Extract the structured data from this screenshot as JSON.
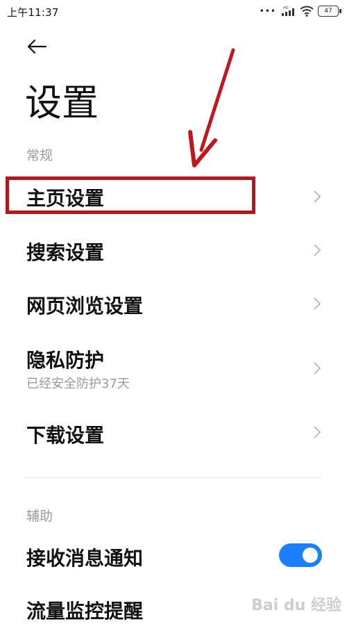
{
  "status": {
    "time": "上午11:37",
    "signal_badge": "HD",
    "battery": "47"
  },
  "page": {
    "title": "设置"
  },
  "sections": {
    "general": {
      "label": "常规",
      "items": [
        {
          "label": "主页设置"
        },
        {
          "label": "搜索设置"
        },
        {
          "label": "网页浏览设置"
        },
        {
          "label": "隐私防护",
          "sub": "已经安全防护37天"
        },
        {
          "label": "下载设置"
        }
      ]
    },
    "assist": {
      "label": "辅助",
      "items": [
        {
          "label": "接收消息通知",
          "toggle_on": true
        },
        {
          "label": "流量监控提醒"
        }
      ]
    }
  },
  "annotation": {
    "highlight_color": "#b3171b",
    "arrow_color": "#c0171c"
  },
  "watermark": {
    "text": "Bai du 经验"
  },
  "colors": {
    "accent": "#1a80ff",
    "secondary_text": "#9a9a9a"
  }
}
